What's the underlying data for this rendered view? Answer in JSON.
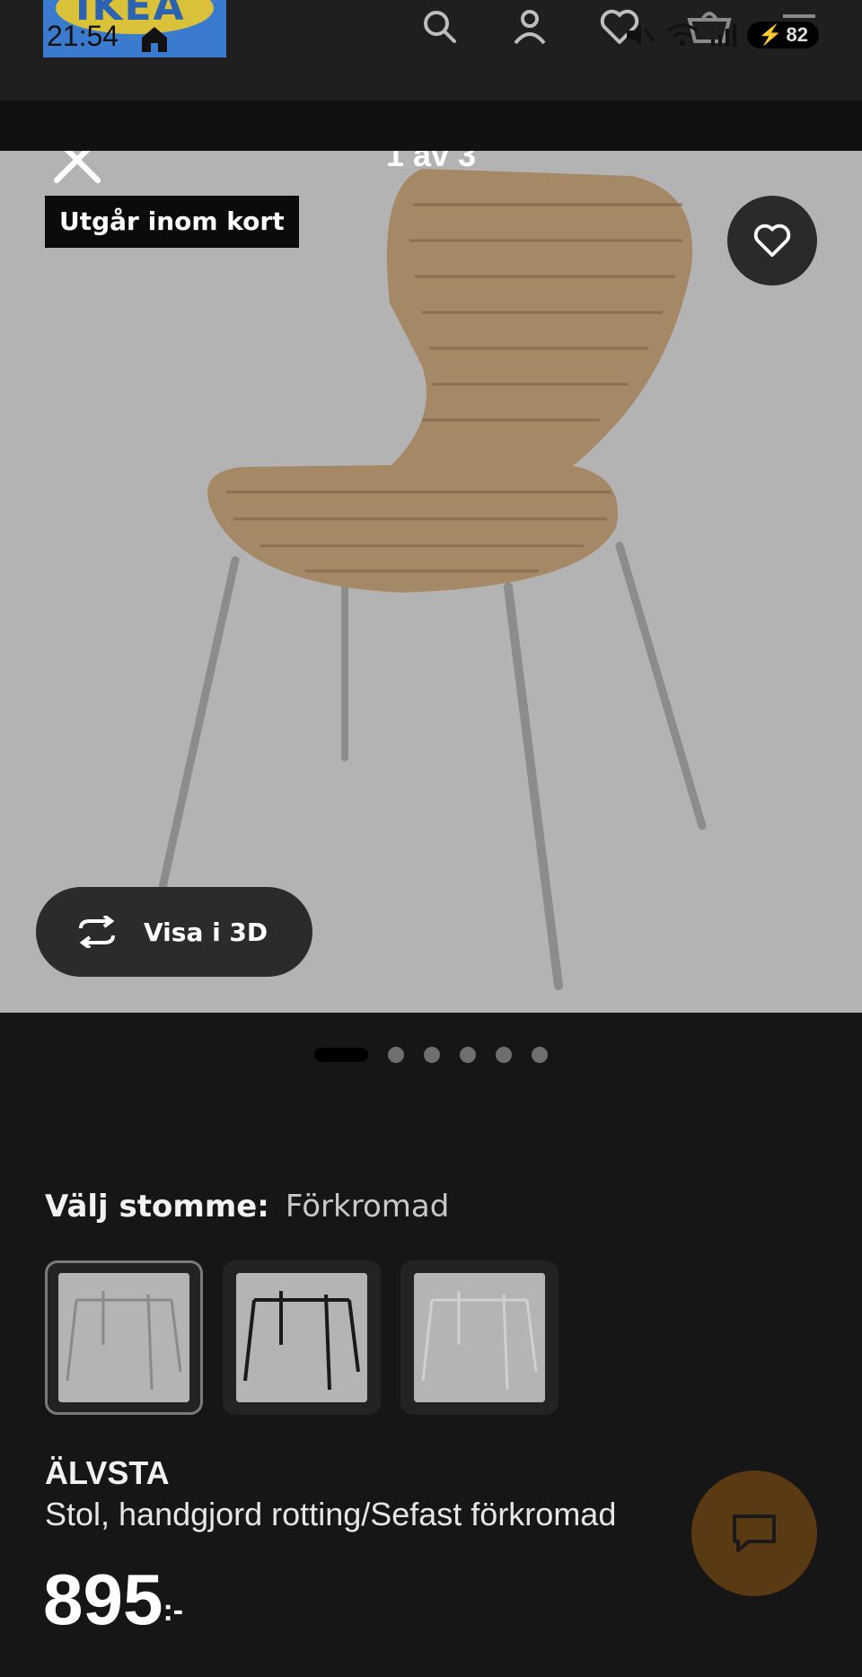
{
  "status_bar": {
    "time": "21:54",
    "battery": "82"
  },
  "header": {
    "logo_text": "IKEA",
    "icons": [
      "search-icon",
      "account-icon",
      "heart-icon",
      "cart-icon",
      "menu-icon"
    ]
  },
  "gallery": {
    "counter": "1 av 3",
    "badge": "Utgår inom kort",
    "view3d_label": "Visa i 3D",
    "dots_count": 6,
    "active_dot": 0
  },
  "variant": {
    "label": "Välj stomme:",
    "value": "Förkromad",
    "options": [
      {
        "name": "frame-option-chrome",
        "selected": true
      },
      {
        "name": "frame-option-black",
        "selected": false
      },
      {
        "name": "frame-option-white",
        "selected": false
      }
    ]
  },
  "product": {
    "name": "ÄLVSTA",
    "description": "Stol, handgjord rotting/Sefast förkromad",
    "price": "895",
    "price_suffix": ":-"
  },
  "colors": {
    "background": "#161616",
    "image_bg": "#b3b3b3",
    "chat_button": "#5a3a12"
  }
}
